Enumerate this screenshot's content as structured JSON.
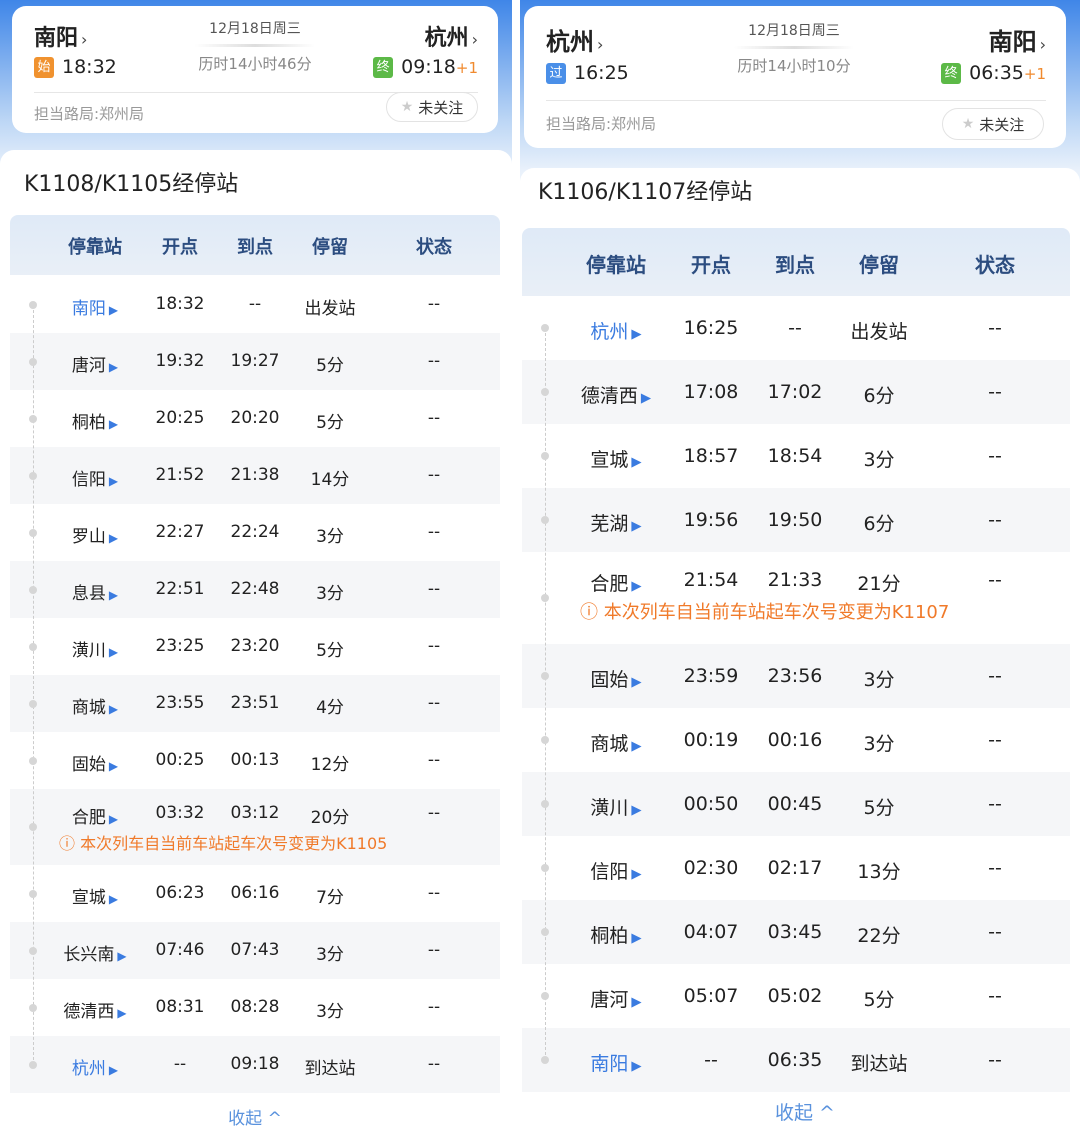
{
  "panels": [
    {
      "from": "南阳",
      "to": "杭州",
      "date": "12月18日周三",
      "duration": "历时14小时46分",
      "dep_badge": "始",
      "dep_badge_color": "#f0922f",
      "dep_time": "18:32",
      "arr_badge": "终",
      "arr_badge_color": "#5cb947",
      "arr_time": "09:18",
      "arr_plus": "+1",
      "bureau": "担当路局:郑州局",
      "follow": "未关注",
      "title": "K1108/K1105经停站",
      "headers": [
        "停靠站",
        "开点",
        "到点",
        "停留",
        "状态"
      ],
      "rows": [
        {
          "station": "南阳",
          "dep": "18:32",
          "arr": "--",
          "stay": "出发站",
          "status": "--",
          "highlight": true
        },
        {
          "station": "唐河",
          "dep": "19:32",
          "arr": "19:27",
          "stay": "5分",
          "status": "--"
        },
        {
          "station": "桐柏",
          "dep": "20:25",
          "arr": "20:20",
          "stay": "5分",
          "status": "--"
        },
        {
          "station": "信阳",
          "dep": "21:52",
          "arr": "21:38",
          "stay": "14分",
          "status": "--"
        },
        {
          "station": "罗山",
          "dep": "22:27",
          "arr": "22:24",
          "stay": "3分",
          "status": "--"
        },
        {
          "station": "息县",
          "dep": "22:51",
          "arr": "22:48",
          "stay": "3分",
          "status": "--"
        },
        {
          "station": "潢川",
          "dep": "23:25",
          "arr": "23:20",
          "stay": "5分",
          "status": "--"
        },
        {
          "station": "商城",
          "dep": "23:55",
          "arr": "23:51",
          "stay": "4分",
          "status": "--"
        },
        {
          "station": "固始",
          "dep": "00:25",
          "arr": "00:13",
          "stay": "12分",
          "status": "--"
        },
        {
          "station": "合肥",
          "dep": "03:32",
          "arr": "03:12",
          "stay": "20分",
          "status": "--",
          "notice": "ⓘ 本次列车自当前车站起车次号变更为K1105"
        },
        {
          "station": "宣城",
          "dep": "06:23",
          "arr": "06:16",
          "stay": "7分",
          "status": "--"
        },
        {
          "station": "长兴南",
          "dep": "07:46",
          "arr": "07:43",
          "stay": "3分",
          "status": "--"
        },
        {
          "station": "德清西",
          "dep": "08:31",
          "arr": "08:28",
          "stay": "3分",
          "status": "--"
        },
        {
          "station": "杭州",
          "dep": "--",
          "arr": "09:18",
          "stay": "到达站",
          "status": "--",
          "highlight": true
        }
      ],
      "collapse": "收起 ^"
    },
    {
      "from": "杭州",
      "to": "南阳",
      "date": "12月18日周三",
      "duration": "历时14小时10分",
      "dep_badge": "过",
      "dep_badge_color": "#4a8fe8",
      "dep_time": "16:25",
      "arr_badge": "终",
      "arr_badge_color": "#5cb947",
      "arr_time": "06:35",
      "arr_plus": "+1",
      "bureau": "担当路局:郑州局",
      "follow": "未关注",
      "title": "K1106/K1107经停站",
      "headers": [
        "停靠站",
        "开点",
        "到点",
        "停留",
        "状态"
      ],
      "rows": [
        {
          "station": "杭州",
          "dep": "16:25",
          "arr": "--",
          "stay": "出发站",
          "status": "--",
          "highlight": true
        },
        {
          "station": "德清西",
          "dep": "17:08",
          "arr": "17:02",
          "stay": "6分",
          "status": "--"
        },
        {
          "station": "宣城",
          "dep": "18:57",
          "arr": "18:54",
          "stay": "3分",
          "status": "--"
        },
        {
          "station": "芜湖",
          "dep": "19:56",
          "arr": "19:50",
          "stay": "6分",
          "status": "--"
        },
        {
          "station": "合肥",
          "dep": "21:54",
          "arr": "21:33",
          "stay": "21分",
          "status": "--",
          "notice": "ⓘ 本次列车自当前车站起车次号变更为K1107"
        },
        {
          "station": "固始",
          "dep": "23:59",
          "arr": "23:56",
          "stay": "3分",
          "status": "--"
        },
        {
          "station": "商城",
          "dep": "00:19",
          "arr": "00:16",
          "stay": "3分",
          "status": "--"
        },
        {
          "station": "潢川",
          "dep": "00:50",
          "arr": "00:45",
          "stay": "5分",
          "status": "--"
        },
        {
          "station": "信阳",
          "dep": "02:30",
          "arr": "02:17",
          "stay": "13分",
          "status": "--"
        },
        {
          "station": "桐柏",
          "dep": "04:07",
          "arr": "03:45",
          "stay": "22分",
          "status": "--"
        },
        {
          "station": "唐河",
          "dep": "05:07",
          "arr": "05:02",
          "stay": "5分",
          "status": "--"
        },
        {
          "station": "南阳",
          "dep": "--",
          "arr": "06:35",
          "stay": "到达站",
          "status": "--",
          "highlight": true
        }
      ],
      "collapse": "收起 ^"
    }
  ]
}
